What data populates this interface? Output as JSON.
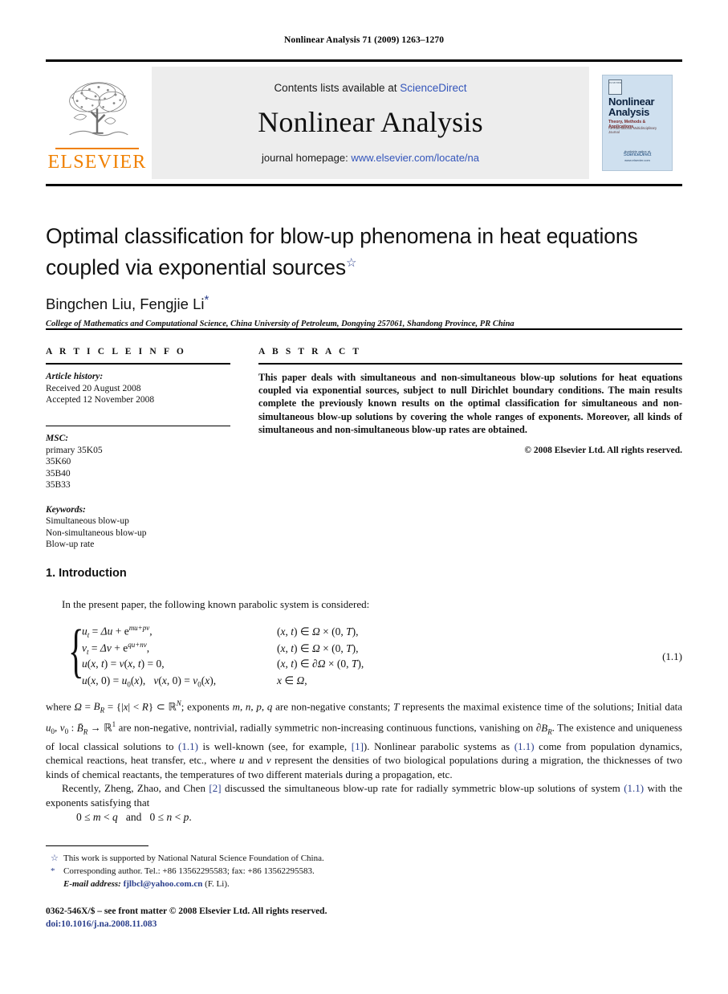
{
  "running_head": "Nonlinear Analysis 71 (2009) 1263–1270",
  "masthead": {
    "publisher_name": "ELSEVIER",
    "contents_prefix": "Contents lists available at ",
    "contents_link": "ScienceDirect",
    "journal_name": "Nonlinear Analysis",
    "homepage_prefix": "journal homepage: ",
    "homepage_url": "www.elsevier.com/locate/na",
    "cover": {
      "logo_text": "ELSEVIER",
      "title_line1": "Nonlinear",
      "title_line2": "Analysis",
      "subtitle": "Theory, Methods & Applications",
      "subtitle2": "An International Multidisciplinary Journal",
      "footer_small": "Available online at",
      "footer_brand": "ScienceDirect",
      "footer_pub": "www.elsevier.com"
    }
  },
  "article": {
    "title_line1": "Optimal classification for blow-up phenomena in heat equations",
    "title_line2": "coupled via exponential sources",
    "title_footnote_mark": "☆",
    "authors": "Bingchen Liu, Fengjie Li",
    "corresponding_mark": "*",
    "affiliation": "College of Mathematics and Computational Science, China University of Petroleum, Dongying 257061, Shandong Province, PR China"
  },
  "article_info": {
    "heading": "A R T I C L E   I N F O",
    "history_label": "Article history:",
    "history": [
      "Received 20 August 2008",
      "Accepted 12 November 2008"
    ],
    "msc_label": "MSC:",
    "msc": [
      "primary 35K05",
      "35K60",
      "35B40",
      "35B33"
    ],
    "keywords_label": "Keywords:",
    "keywords": [
      "Simultaneous blow-up",
      "Non-simultaneous blow-up",
      "Blow-up rate"
    ]
  },
  "abstract": {
    "heading": "A B S T R A C T",
    "text": "This paper deals with simultaneous and non-simultaneous blow-up solutions for heat equations coupled via exponential sources, subject to null Dirichlet boundary conditions. The main results complete the previously known results on the optimal classification for simultaneous and non-simultaneous blow-up solutions by covering the whole ranges of exponents. Moreover, all kinds of simultaneous and non-simultaneous blow-up rates are obtained.",
    "copyright": "© 2008 Elsevier Ltd. All rights reserved."
  },
  "body": {
    "section_number": "1.",
    "section_title": "Introduction",
    "para1_intro": "In the present paper, the following known parabolic system is considered:",
    "equation": {
      "number": "(1.1)",
      "rows": [
        {
          "lhs": "u_t = Δu + e^{mu+pv},",
          "rhs": "(x, t) ∈ Ω × (0, T),"
        },
        {
          "lhs": "v_t = Δv + e^{qu+nv},",
          "rhs": "(x, t) ∈ Ω × (0, T),"
        },
        {
          "lhs": "u(x, t) = v(x, t) = 0,",
          "rhs": "(x, t) ∈ ∂Ω × (0, T),"
        },
        {
          "lhs": "u(x, 0) = u₀(x),   v(x, 0) = v₀(x),",
          "rhs": "x ∈ Ω,"
        }
      ]
    },
    "para_where": "where Ω = B_R = {|x| < R} ⊂ ℝ^N; exponents m, n, p, q are non-negative constants; T represents the maximal existence time of the solutions; Initial data u₀, v₀ : B̄_R → ℝ¹ are non-negative, nontrivial, radially symmetric non-increasing continuous functions, vanishing on ∂B_R. The existence and uniqueness of local classical solutions to (1.1) is well-known (see, for example, [1]). Nonlinear parabolic systems as (1.1) come from population dynamics, chemical reactions, heat transfer, etc., where u and v represent the densities of two biological populations during a migration, the thicknesses of two kinds of chemical reactants, the temperatures of two different materials during a propagation, etc.",
    "para_recently": "Recently, Zheng, Zhao, and Chen [2] discussed the simultaneous blow-up rate for radially symmetric blow-up solutions of system (1.1) with the exponents satisfying that",
    "condition": "0 ≤ m < q   and   0 ≤ n < p."
  },
  "footnotes": {
    "funding_mark": "☆",
    "funding": "This work is supported by National Natural Science Foundation of China.",
    "corresponding_mark": "*",
    "corresponding": "Corresponding author. Tel.: +86 13562295583; fax: +86 13562295583.",
    "email_label": "E-mail address:",
    "email": "fjlbcl@yahoo.com.cn",
    "email_author": "(F. Li).",
    "issn_line": "0362-546X/$ – see front matter © 2008 Elsevier Ltd. All rights reserved.",
    "doi_line": "doi:10.1016/j.na.2008.11.083"
  }
}
